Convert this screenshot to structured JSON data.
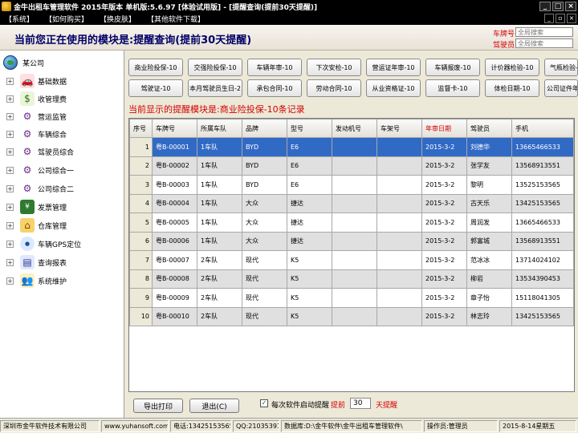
{
  "window": {
    "title": "金牛出租车管理软件 2015年版本 单机版:5.6.97 [体验试用版] - [提醒查询(提前30天提醒)]"
  },
  "menu": [
    "【系统】",
    "【如何购买】",
    "【换皮肤】",
    "【其他软件下载】"
  ],
  "header": {
    "current_module": "当前您正在使用的模块是:提醒查询(提前30天提醒)",
    "plate_label": "车牌号",
    "driver_label": "驾驶员",
    "plate_placeholder": "全局搜索",
    "driver_placeholder": "全局搜索"
  },
  "tree": {
    "root": "某公司",
    "nodes": [
      {
        "label": "基础数据",
        "icon": "car-icon"
      },
      {
        "label": "收管理费",
        "icon": "money-bag-icon"
      },
      {
        "label": "营运监管",
        "icon": "gear-icon"
      },
      {
        "label": "车辆综合",
        "icon": "gear-icon"
      },
      {
        "label": "驾驶员综合",
        "icon": "gear-icon"
      },
      {
        "label": "公司综合一",
        "icon": "gear-icon"
      },
      {
        "label": "公司综合二",
        "icon": "gear-icon"
      },
      {
        "label": "发票管理",
        "icon": "invoice-icon"
      },
      {
        "label": "仓库管理",
        "icon": "warehouse-icon"
      },
      {
        "label": "车辆GPS定位",
        "icon": "gps-icon"
      },
      {
        "label": "查询报表",
        "icon": "report-icon"
      },
      {
        "label": "系统维护",
        "icon": "users-icon"
      }
    ]
  },
  "tabs": {
    "row1": [
      "商业险投保-10",
      "交强险投保-10",
      "车辆年审-10",
      "下次安检-10",
      "营运证年审-10",
      "车辆报废-10",
      "计价器检验-10",
      "气瓶检验-10"
    ],
    "row2": [
      "驾驶证-10",
      "本月驾驶员生日-2",
      "承包合同-10",
      "劳动合同-10",
      "从业资格证-10",
      "监督卡-10",
      "体检日期-10",
      "公司证件年审-10"
    ]
  },
  "current_shown": "当前显示的提醒模块是:商业险投保-10条记录",
  "table": {
    "columns": [
      "序号",
      "车牌号",
      "所属车队",
      "品牌",
      "型号",
      "发动机号",
      "车架号",
      "年审日期",
      "驾驶员",
      "手机"
    ],
    "rows": [
      [
        "1",
        "粤B-00001",
        "1车队",
        "BYD",
        "E6",
        "",
        "",
        "2015-3-2",
        "刘德华",
        "13665466533"
      ],
      [
        "2",
        "粤B-00002",
        "1车队",
        "BYD",
        "E6",
        "",
        "",
        "2015-3-2",
        "张学友",
        "13568913551"
      ],
      [
        "3",
        "粤B-00003",
        "1车队",
        "BYD",
        "E6",
        "",
        "",
        "2015-3-2",
        "黎明",
        "13525153565"
      ],
      [
        "4",
        "粤B-00004",
        "1车队",
        "大众",
        "捷达",
        "",
        "",
        "2015-3-2",
        "古天乐",
        "13425153565"
      ],
      [
        "5",
        "粤B-00005",
        "1车队",
        "大众",
        "捷达",
        "",
        "",
        "2015-3-2",
        "周润发",
        "13665466533"
      ],
      [
        "6",
        "粤B-00006",
        "1车队",
        "大众",
        "捷达",
        "",
        "",
        "2015-3-2",
        "郭富城",
        "13568913551"
      ],
      [
        "7",
        "粤B-00007",
        "2车队",
        "现代",
        "K5",
        "",
        "",
        "2015-3-2",
        "范冰冰",
        "13714024102"
      ],
      [
        "8",
        "粤B-00008",
        "2车队",
        "现代",
        "K5",
        "",
        "",
        "2015-3-2",
        "柳岩",
        "13534390453"
      ],
      [
        "9",
        "粤B-00009",
        "2车队",
        "现代",
        "K5",
        "",
        "",
        "2015-3-2",
        "章子怡",
        "15118041305"
      ],
      [
        "10",
        "粤B-00010",
        "2车队",
        "现代",
        "K5",
        "",
        "",
        "2015-3-2",
        "林志玲",
        "13425153565"
      ]
    ]
  },
  "bottom": {
    "export_label": "导出打印",
    "exit_label": "退出(C)",
    "startup_reminder_label": "每次软件启动提醒",
    "ahead_label": "提前",
    "ahead_days": "30",
    "days_label": "天提醒"
  },
  "status": {
    "company": "深圳市金牛软件技术有限公司",
    "website": "www.yuhansoft.com",
    "phone": "电话:13425153565",
    "qq": "QQ:21035391",
    "database": "数据库:D:\\金牛软件\\金牛出租车管理软件\\",
    "operator": "操作员:管理员",
    "date": "2015-8-14星期五"
  },
  "colors": {
    "selected_row": "#316ac5",
    "highlight_red": "#d40000",
    "title_blue": "#000066"
  }
}
